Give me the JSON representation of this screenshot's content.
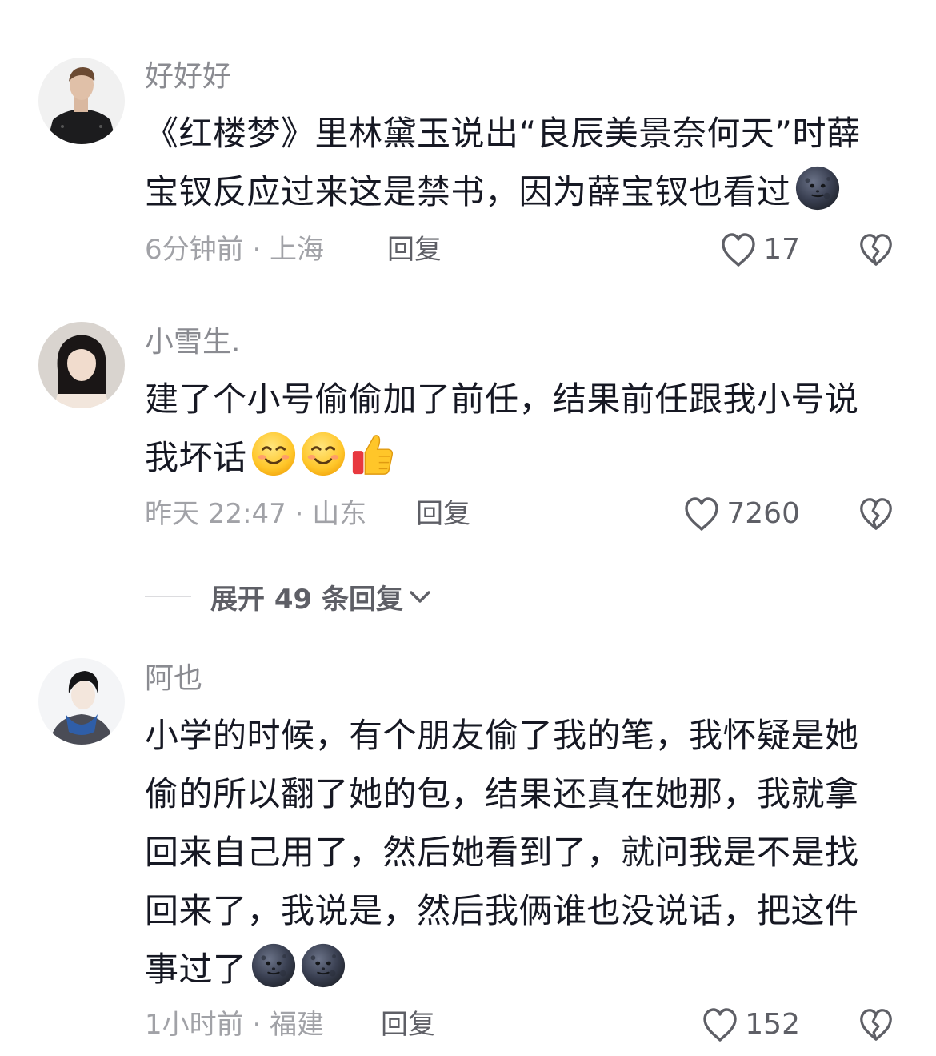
{
  "comments": [
    {
      "username": "好好好",
      "text": "《红楼梦》里林黛玉说出“良辰美景奈何天”时薛宝钗反应过来这是禁书，因为薛宝钗也看过",
      "emojis": [
        "new-moon-face-emoji"
      ],
      "time_location": "6分钟前 · 上海",
      "reply_label": "回复",
      "like_count": "17"
    },
    {
      "username": "小雪生.",
      "text": "建了个小号偷偷加了前任，结果前任跟我小号说我坏话",
      "emojis": [
        "smiling-face-emoji",
        "smiling-face-emoji",
        "thumbs-up-emoji"
      ],
      "time_location": "昨天 22:47 · 山东",
      "reply_label": "回复",
      "like_count": "7260"
    },
    {
      "username": "阿也",
      "text": "小学的时候，有个朋友偷了我的笔，我怀疑是她偷的所以翻了她的包，结果还真在她那，我就拿回来自己用了，然后她看到了，就问我是不是找回来了，我说是，然后我俩谁也没说话，把这件事过了",
      "emojis": [
        "new-moon-face-emoji",
        "new-moon-face-emoji"
      ],
      "time_location": "1小时前 · 福建",
      "reply_label": "回复",
      "like_count": "152"
    }
  ],
  "expand_replies": {
    "label": "展开 49 条回复"
  },
  "colors": {
    "username": "#8a8b91",
    "text": "#161823",
    "meta": "#a1a2a7",
    "action": "#5e5f66"
  }
}
